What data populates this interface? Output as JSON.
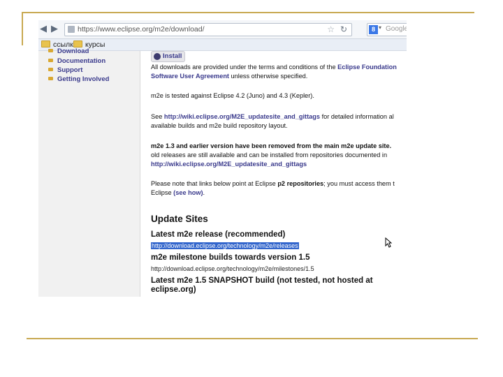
{
  "browser": {
    "url": "https://www.eclipse.org/m2e/download/",
    "search_placeholder": "Google",
    "search_engine_letter": "8",
    "back_icon": "back-arrow-icon",
    "forward_icon": "forward-arrow-icon"
  },
  "bookmarks": [
    {
      "label": "ссылки"
    },
    {
      "label": "курсы"
    }
  ],
  "sidebar": {
    "items": [
      {
        "label": "Download"
      },
      {
        "label": "Documentation"
      },
      {
        "label": "Support"
      },
      {
        "label": "Getting Involved"
      }
    ]
  },
  "content": {
    "install_label": "Install",
    "p1_text": "All downloads are provided under the terms and conditions of the ",
    "p1_link": "Eclipse Foundation",
    "p1_line2_link": "Software User Agreement",
    "p1_line2_rest": " unless otherwise specified.",
    "p2": "m2e is tested against Eclipse 4.2 (Juno) and 4.3 (Kepler).",
    "p3_see": "See ",
    "p3_link": "http://wiki.eclipse.org/M2E_updatesite_and_gittags",
    "p3_rest": " for detailed information al",
    "p3_line2": "available builds and m2e build repository layout.",
    "p4_bold": "m2e 1.3 and earlier version have been removed from the main m2e update site.",
    "p4_line2": "old releases are still available and can be installed from repositories documented in",
    "p4_link": "http://wiki.eclipse.org/M2E_updatesite_and_gittags",
    "p5_text": "Please note that links below point at Eclipse ",
    "p5_bold": "p2 repositories",
    "p5_rest": "; you must access them t",
    "p5_line2": "Eclipse ",
    "p5_link": "(see how)",
    "p5_end": ".",
    "update_sites_heading": "Update Sites",
    "latest_release_heading": "Latest m2e release (recommended)",
    "latest_release_url": "http://download.eclipse.org/technology/m2e/releases",
    "milestone_heading": "m2e milestone builds towards version 1.5",
    "milestone_url": "http://download.eclipse.org/technology/m2e/milestones/1.5",
    "snapshot_heading_line1": "Latest m2e 1.5 SNAPSHOT build (not tested, not hosted at",
    "snapshot_heading_line2": "eclipse.org)"
  },
  "colors": {
    "accent_rule": "#c8a951",
    "link": "#3a3a8c",
    "selection": "#3366cc"
  }
}
